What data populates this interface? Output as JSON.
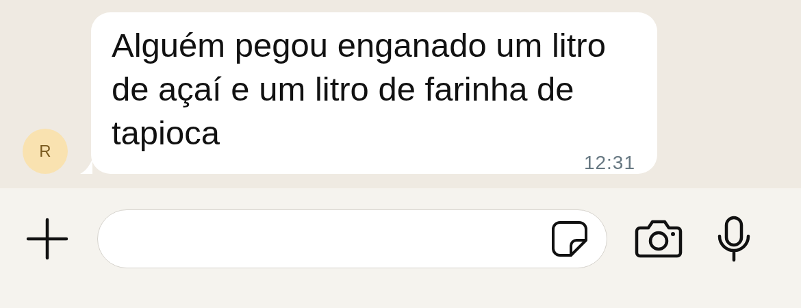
{
  "message": {
    "sender_initial": "R",
    "text": "Alguém pegou enganado um litro de açaí e um litro de farinha de tapioca",
    "time": "12:31"
  }
}
